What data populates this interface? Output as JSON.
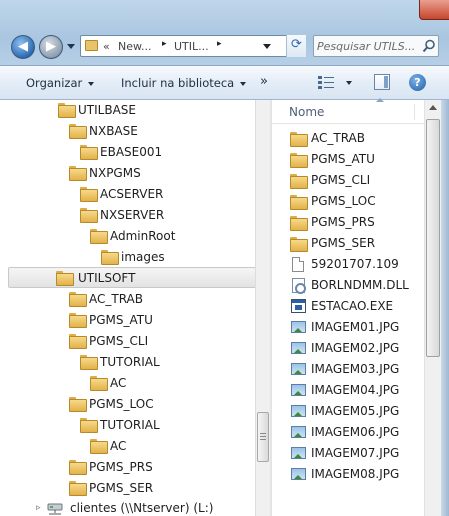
{
  "address": {
    "chevrons": "«",
    "segments": [
      "New...",
      "UTIL..."
    ],
    "separator": "▸"
  },
  "search": {
    "placeholder": "Pesquisar UTILS..."
  },
  "toolbar": {
    "organize_label": "Organizar",
    "include_label": "Incluir na biblioteca",
    "more_label": "»",
    "help_label": "?"
  },
  "nav_tree": [
    {
      "label": "UTILBASE"
    },
    {
      "label": "NXBASE"
    },
    {
      "label": "EBASE001"
    },
    {
      "label": "NXPGMS"
    },
    {
      "label": "ACSERVER"
    },
    {
      "label": "NXSERVER"
    },
    {
      "label": "AdminRoot"
    },
    {
      "label": "images"
    },
    {
      "label": "UTILSOFT",
      "selected": true
    },
    {
      "label": "AC_TRAB"
    },
    {
      "label": "PGMS_ATU"
    },
    {
      "label": "PGMS_CLI"
    },
    {
      "label": "TUTORIAL"
    },
    {
      "label": "AC"
    },
    {
      "label": "PGMS_LOC"
    },
    {
      "label": "TUTORIAL"
    },
    {
      "label": "AC"
    },
    {
      "label": "PGMS_PRS"
    },
    {
      "label": "PGMS_SER"
    },
    {
      "label": "clientes (\\\\Ntserver) (L:)",
      "icon": "network-drive-icon"
    }
  ],
  "content": {
    "column_name": "Nome",
    "files": [
      {
        "name": "AC_TRAB",
        "icon": "folder-icon"
      },
      {
        "name": "PGMS_ATU",
        "icon": "folder-icon"
      },
      {
        "name": "PGMS_CLI",
        "icon": "folder-icon"
      },
      {
        "name": "PGMS_LOC",
        "icon": "folder-icon"
      },
      {
        "name": "PGMS_PRS",
        "icon": "folder-icon"
      },
      {
        "name": "PGMS_SER",
        "icon": "folder-icon"
      },
      {
        "name": "59201707.109",
        "icon": "file-icon"
      },
      {
        "name": "BORLNDMM.DLL",
        "icon": "dll-icon"
      },
      {
        "name": "ESTACAO.EXE",
        "icon": "exe-icon"
      },
      {
        "name": "IMAGEM01.JPG",
        "icon": "image-icon"
      },
      {
        "name": "IMAGEM02.JPG",
        "icon": "image-icon"
      },
      {
        "name": "IMAGEM03.JPG",
        "icon": "image-icon"
      },
      {
        "name": "IMAGEM04.JPG",
        "icon": "image-icon"
      },
      {
        "name": "IMAGEM05.JPG",
        "icon": "image-icon"
      },
      {
        "name": "IMAGEM06.JPG",
        "icon": "image-icon"
      },
      {
        "name": "IMAGEM07.JPG",
        "icon": "image-icon"
      },
      {
        "name": "IMAGEM08.JPG",
        "icon": "image-icon"
      }
    ]
  },
  "colors": {
    "folder": "#e9c36a",
    "selection": "#e3e3e3",
    "header_text": "#4c607a"
  }
}
